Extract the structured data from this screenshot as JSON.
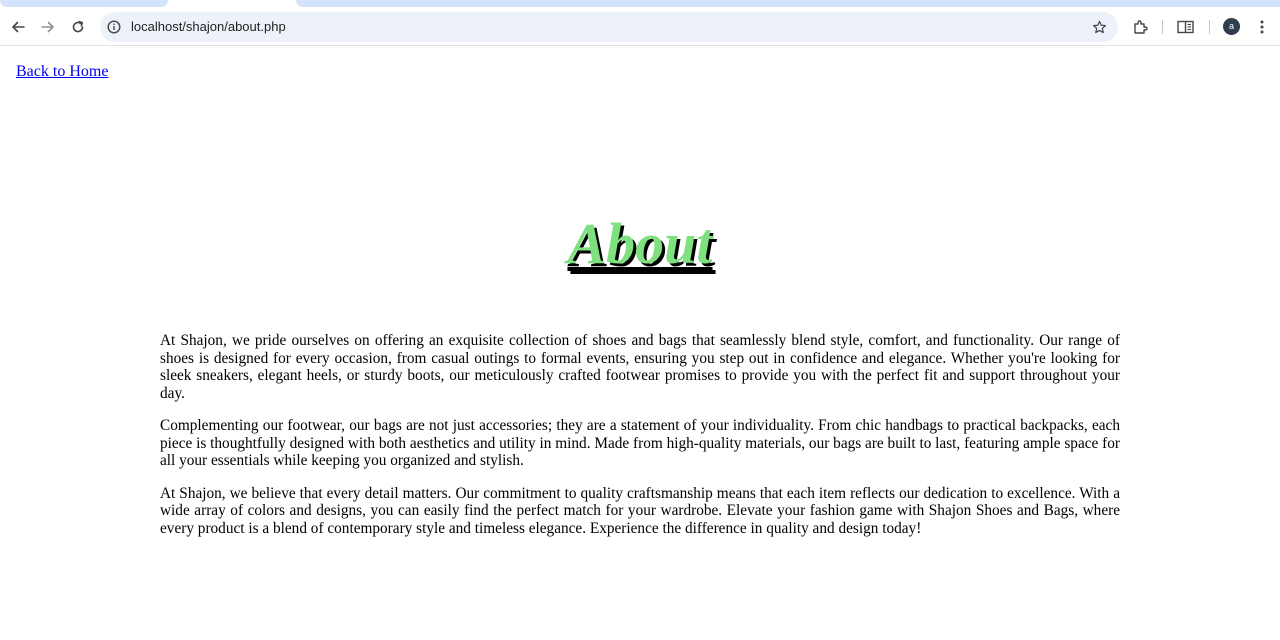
{
  "browser": {
    "url": "localhost/shajon/about.php",
    "profile_initial": "a",
    "icons": {
      "back": "arrow-left-icon",
      "forward": "arrow-right-icon",
      "reload": "reload-icon",
      "site_info": "info-icon",
      "bookmark": "star-icon",
      "extensions": "puzzle-icon",
      "reading_mode": "reading-mode-icon",
      "menu": "kebab-menu-icon"
    }
  },
  "page": {
    "back_link": "Back to Home",
    "heading": "About",
    "heading_color": "#7fe07f",
    "paragraphs": [
      "At Shajon, we pride ourselves on offering an exquisite collection of shoes and bags that seamlessly blend style, comfort, and functionality. Our range of shoes is designed for every occasion, from casual outings to formal events, ensuring you step out in confidence and elegance. Whether you're looking for sleek sneakers, elegant heels, or sturdy boots, our meticulously crafted footwear promises to provide you with the perfect fit and support throughout your day.",
      "Complementing our footwear, our bags are not just accessories; they are a statement of your individuality. From chic handbags to practical backpacks, each piece is thoughtfully designed with both aesthetics and utility in mind. Made from high-quality materials, our bags are built to last, featuring ample space for all your essentials while keeping you organized and stylish.",
      "At Shajon, we believe that every detail matters. Our commitment to quality craftsmanship means that each item reflects our dedication to excellence. With a wide array of colors and designs, you can easily find the perfect match for your wardrobe. Elevate your fashion game with Shajon Shoes and Bags, where every product is a blend of contemporary style and timeless elegance. Experience the difference in quality and design today!"
    ]
  }
}
